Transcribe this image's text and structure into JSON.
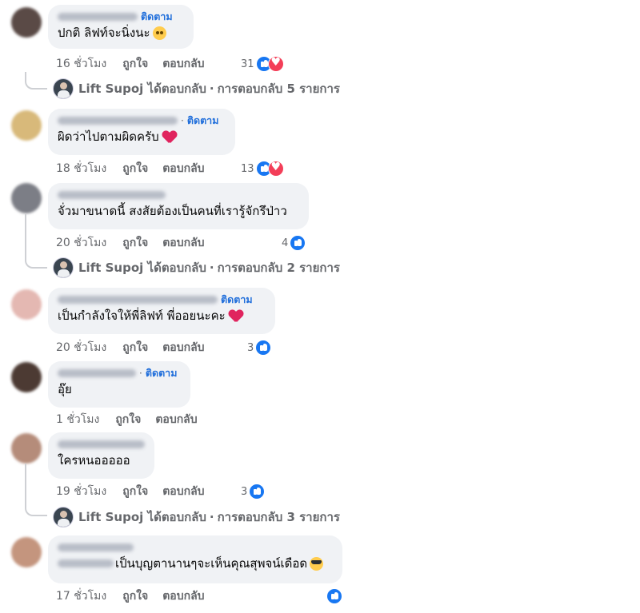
{
  "labels": {
    "follow": "ติดตาม",
    "like": "ถูกใจ",
    "reply": "ตอบกลับ",
    "replied": "ได้ตอบกลับ",
    "dot": "·"
  },
  "comments": [
    {
      "text": "ปกติ ลิฟท์จะนิ่งนะ",
      "emoji": "flushed-face",
      "time": "16 ชั่วโมง",
      "reactions": {
        "count": "31",
        "types": [
          "like",
          "love"
        ]
      },
      "reply_thread": {
        "name": "Lift Supoj",
        "summary": "การตอบกลับ 5 รายการ"
      }
    },
    {
      "text": "ผิดว่าไปตามผิดครับ",
      "emoji": "red-heart",
      "time": "18 ชั่วโมง",
      "reactions": {
        "count": "13",
        "types": [
          "like",
          "love"
        ]
      }
    },
    {
      "text": "จั่วมาขนาดนี้ สงสัยต้องเป็นคนที่เรารู้จักรึป่าว",
      "time": "20 ชั่วโมง",
      "reactions": {
        "count": "4",
        "types": [
          "like"
        ]
      },
      "reply_thread": {
        "name": "Lift Supoj",
        "summary": "การตอบกลับ 2 รายการ"
      }
    },
    {
      "text": "เป็นกำลังใจให้พี่ลิฟท์ พี่ออยนะคะ",
      "emoji": "red-heart",
      "time": "20 ชั่วโมง",
      "reactions": {
        "count": "3",
        "types": [
          "like"
        ]
      }
    },
    {
      "text": "อุ๊ย",
      "time": "1 ชั่วโมง"
    },
    {
      "text": "ใครหนอออออ",
      "time": "19 ชั่วโมง",
      "reactions": {
        "count": "3",
        "types": [
          "like"
        ]
      },
      "reply_thread": {
        "name": "Lift Supoj",
        "summary": "การตอบกลับ 3 รายการ"
      }
    },
    {
      "text": "เป็นบุญตานานๆจะเห็นคุณสุพจน์เดือด",
      "emoji": "smiling-face-with-sunglasses",
      "time": "17 ชั่วโมง",
      "reactions": {
        "count": "",
        "types": [
          "like"
        ]
      }
    }
  ],
  "colors": {
    "accent": "#216fdb",
    "bubble": "#f0f2f5",
    "meta_text": "#65676b",
    "like": "#1877f2",
    "love": "#f33e58"
  }
}
